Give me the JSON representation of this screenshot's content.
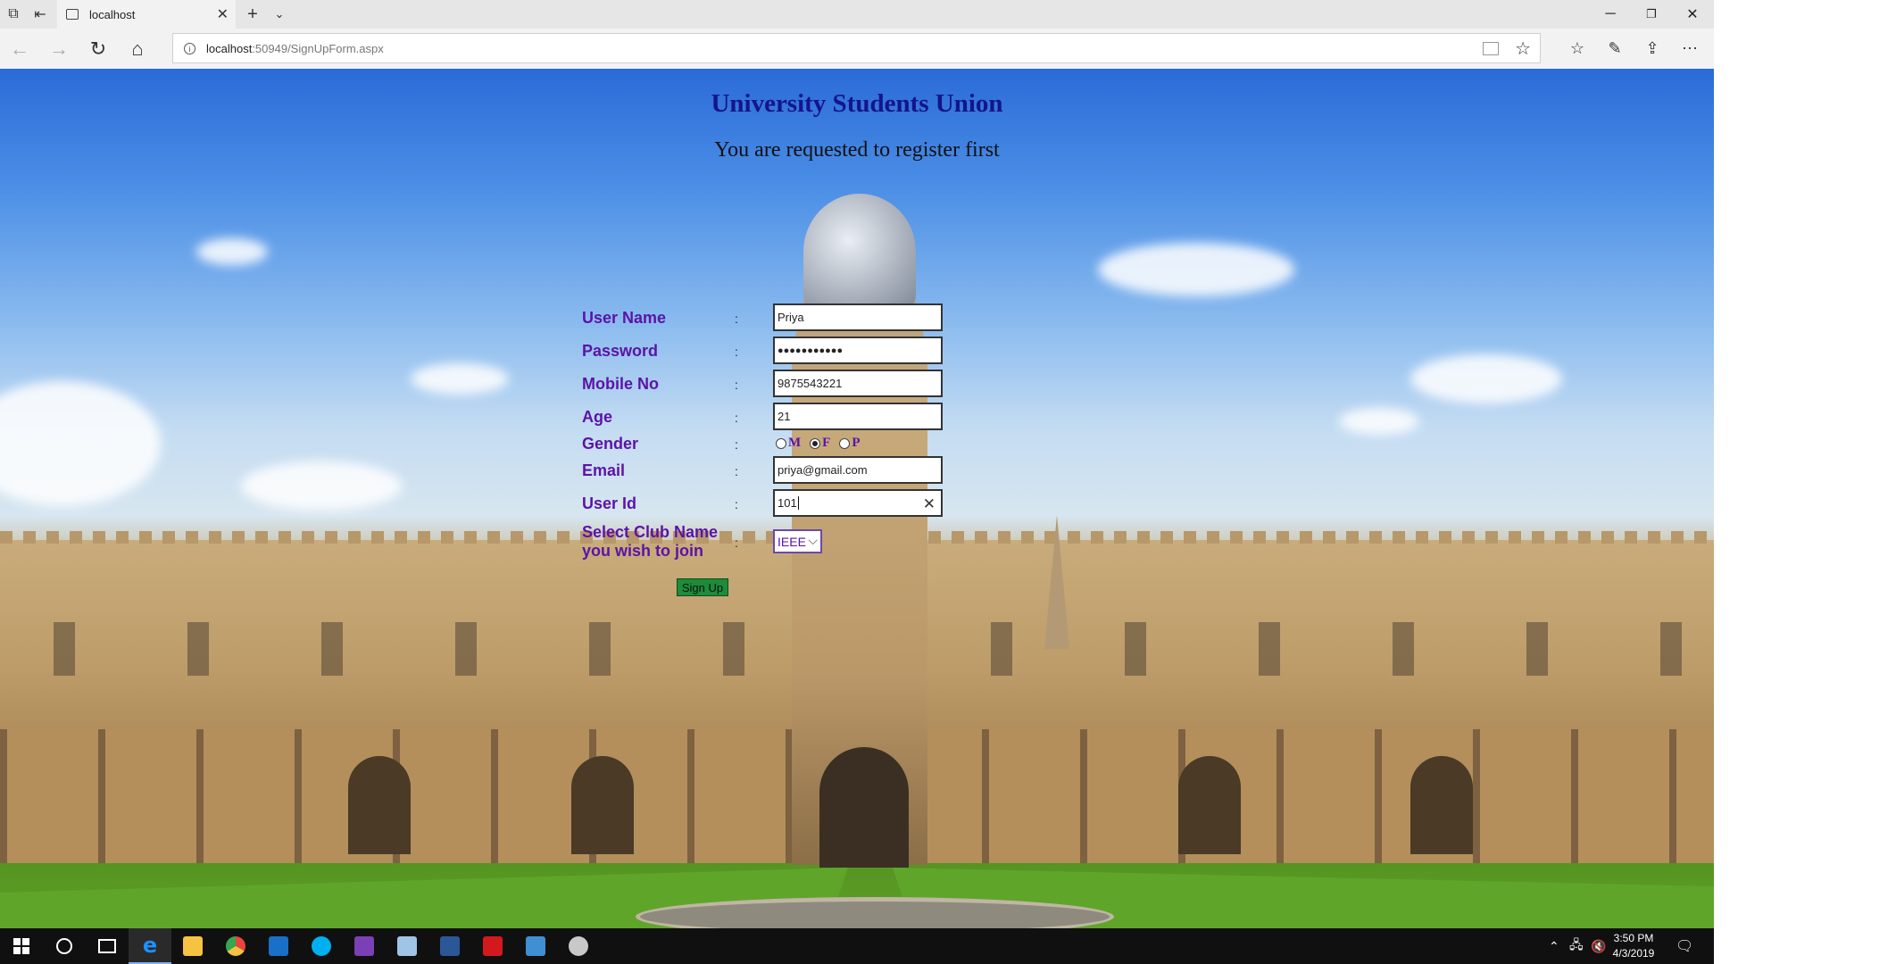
{
  "browser": {
    "tab_title": "localhost",
    "url_host": "localhost",
    "url_path": ":50949/SignUpForm.aspx"
  },
  "form": {
    "title": "University Students Union",
    "subtitle": "You are requested to register first",
    "colon": ":",
    "labels": {
      "username": "User Name",
      "password": "Password",
      "mobile": "Mobile No",
      "age": "Age",
      "gender": "Gender",
      "email": "Email",
      "userid": "User Id",
      "club_line1": "Select Club Name",
      "club_line2": "you wish to join"
    },
    "values": {
      "username": "Priya",
      "password": "●●●●●●●●●●●",
      "mobile": "9875543221",
      "age": "21",
      "email": "priya@gmail.com",
      "userid": "101"
    },
    "gender_options": [
      "M",
      "F",
      "P"
    ],
    "gender_selected": "F",
    "club_selected": "IEEE",
    "submit_label": "Sign Up"
  },
  "taskbar": {
    "time": "3:50 PM",
    "date": "4/3/2019",
    "colors": {
      "edge": "#1e90ff",
      "explorer": "#f5c242",
      "chrome": "#e8453c",
      "outlook": "#1a6fc9",
      "skype": "#00aff0",
      "visual_studio": "#7b3fb6",
      "word": "#2b5797",
      "acrobat": "#d4191c"
    }
  }
}
